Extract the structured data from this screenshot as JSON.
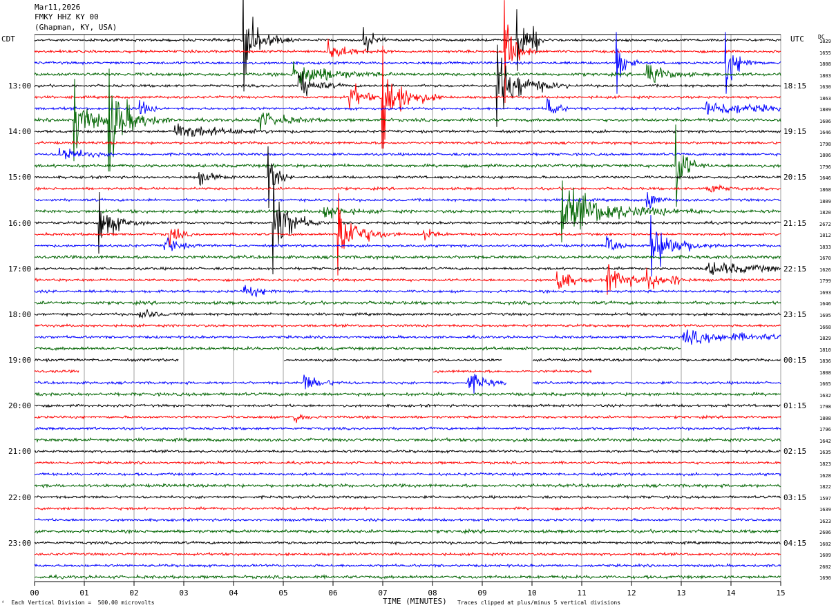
{
  "header": {
    "date": "Mar11,2026",
    "station": "FMKY HHZ KY 00",
    "location": "(Ghapman, KY, USA)"
  },
  "left_axis_label": "CDT",
  "right_axis_label": "UTC",
  "dc_label": "DC",
  "footer": {
    "scale_note": "Each Vertical Division =  500.00 microvolts",
    "xlabel": "TIME (MINUTES)",
    "clip_note": "Traces clipped at plus/minus 5 vertical divisions"
  },
  "colors": {
    "black": "#000000",
    "red": "#ff0000",
    "blue": "#0000ff",
    "green": "#006400",
    "grid": "#888888"
  },
  "chart_data": {
    "type": "helicorder",
    "title": "FMKY HHZ KY 00",
    "xlabel": "TIME (MINUTES)",
    "x_ticks": [
      "00",
      "01",
      "02",
      "03",
      "04",
      "05",
      "06",
      "07",
      "08",
      "09",
      "10",
      "11",
      "12",
      "13",
      "14",
      "15"
    ],
    "xlim": [
      0,
      15
    ],
    "trace_count": 48,
    "trace_minutes": 15,
    "color_cycle": [
      "black",
      "red",
      "blue",
      "green"
    ],
    "left_time_labels": [
      "13:00",
      "14:00",
      "15:00",
      "16:00",
      "17:00",
      "18:00",
      "19:00",
      "20:00",
      "21:00",
      "22:00",
      "23:00"
    ],
    "left_label_rows": [
      4,
      8,
      12,
      16,
      20,
      24,
      28,
      32,
      36,
      40,
      44
    ],
    "right_time_labels": [
      "18:15",
      "19:15",
      "20:15",
      "21:15",
      "22:15",
      "23:15",
      "00:15",
      "01:15",
      "02:15",
      "03:15",
      "04:15"
    ],
    "dc_offsets": [
      "1829",
      "1655",
      "1808",
      "1803",
      "1630",
      "1863",
      "1809",
      "1606",
      "1646",
      "1798",
      "1806",
      "1796",
      "1646",
      "1868",
      "1809",
      "1820",
      "2672",
      "1812",
      "1833",
      "1670",
      "1626",
      "1799",
      "1693",
      "1646",
      "1695",
      "1668",
      "1829",
      "1810",
      "1836",
      "1808",
      "1665",
      "1632",
      "1798",
      "1808",
      "1796",
      "1642",
      "1635",
      "1823",
      "1628",
      "1822",
      "1597",
      "1639",
      "1623",
      "2606",
      "1602",
      "1609",
      "2602",
      "1690"
    ],
    "events": [
      {
        "row": 0,
        "t": 4.2,
        "amp": 5,
        "dur": 0.4
      },
      {
        "row": 0,
        "t": 6.6,
        "amp": 2.5,
        "dur": 0.2
      },
      {
        "row": 0,
        "t": 9.7,
        "amp": 3,
        "dur": 0.2
      },
      {
        "row": 0,
        "t": 10.0,
        "amp": 2.5,
        "dur": 0.15
      },
      {
        "row": 1,
        "t": 9.45,
        "amp": 5,
        "dur": 0.25
      },
      {
        "row": 1,
        "t": 5.9,
        "amp": 1.2,
        "dur": 0.5
      },
      {
        "row": 2,
        "t": 11.7,
        "amp": 3,
        "dur": 0.2
      },
      {
        "row": 2,
        "t": 13.9,
        "amp": 3,
        "dur": 0.3
      },
      {
        "row": 3,
        "t": 5.2,
        "amp": 2,
        "dur": 0.8
      },
      {
        "row": 3,
        "t": 12.3,
        "amp": 2,
        "dur": 0.4
      },
      {
        "row": 4,
        "t": 5.3,
        "amp": 2,
        "dur": 0.4
      },
      {
        "row": 4,
        "t": 9.3,
        "amp": 4,
        "dur": 0.6
      },
      {
        "row": 5,
        "t": 7.0,
        "amp": 5,
        "dur": 0.5
      },
      {
        "row": 5,
        "t": 6.3,
        "amp": 2.5,
        "dur": 0.3
      },
      {
        "row": 6,
        "t": 2.1,
        "amp": 1.5,
        "dur": 0.2
      },
      {
        "row": 6,
        "t": 10.3,
        "amp": 2,
        "dur": 0.2
      },
      {
        "row": 6,
        "t": 13.5,
        "amp": 1,
        "dur": 1.3
      },
      {
        "row": 7,
        "t": 0.8,
        "amp": 4,
        "dur": 0.4
      },
      {
        "row": 7,
        "t": 1.5,
        "amp": 5,
        "dur": 0.5
      },
      {
        "row": 7,
        "t": 4.5,
        "amp": 1.2,
        "dur": 0.6
      },
      {
        "row": 8,
        "t": 2.8,
        "amp": 1.2,
        "dur": 1.0
      },
      {
        "row": 10,
        "t": 0.5,
        "amp": 1.2,
        "dur": 0.5
      },
      {
        "row": 11,
        "t": 12.9,
        "amp": 4,
        "dur": 0.25
      },
      {
        "row": 12,
        "t": 3.3,
        "amp": 1,
        "dur": 0.3
      },
      {
        "row": 12,
        "t": 4.7,
        "amp": 3,
        "dur": 0.2
      },
      {
        "row": 13,
        "t": 13.5,
        "amp": 1,
        "dur": 0.3
      },
      {
        "row": 14,
        "t": 12.3,
        "amp": 2,
        "dur": 0.2
      },
      {
        "row": 15,
        "t": 5.8,
        "amp": 1,
        "dur": 0.5
      },
      {
        "row": 15,
        "t": 10.6,
        "amp": 3,
        "dur": 1.2
      },
      {
        "row": 16,
        "t": 1.3,
        "amp": 3,
        "dur": 0.4
      },
      {
        "row": 16,
        "t": 4.8,
        "amp": 5,
        "dur": 0.4
      },
      {
        "row": 17,
        "t": 2.7,
        "amp": 2,
        "dur": 0.2
      },
      {
        "row": 17,
        "t": 6.1,
        "amp": 4,
        "dur": 0.5
      },
      {
        "row": 17,
        "t": 7.8,
        "amp": 1.5,
        "dur": 0.2
      },
      {
        "row": 18,
        "t": 2.6,
        "amp": 1.5,
        "dur": 0.3
      },
      {
        "row": 18,
        "t": 12.4,
        "amp": 3,
        "dur": 0.6
      },
      {
        "row": 18,
        "t": 11.5,
        "amp": 1.5,
        "dur": 0.2
      },
      {
        "row": 20,
        "t": 13.5,
        "amp": 0.8,
        "dur": 1.5
      },
      {
        "row": 21,
        "t": 10.5,
        "amp": 2,
        "dur": 0.3
      },
      {
        "row": 21,
        "t": 11.5,
        "amp": 2,
        "dur": 0.5
      },
      {
        "row": 21,
        "t": 12.3,
        "amp": 1.5,
        "dur": 0.3
      },
      {
        "row": 21,
        "t": 12.8,
        "amp": 1.2,
        "dur": 0.2
      },
      {
        "row": 22,
        "t": 4.2,
        "amp": 1,
        "dur": 0.4
      },
      {
        "row": 24,
        "t": 2.1,
        "amp": 1,
        "dur": 0.3
      },
      {
        "row": 26,
        "t": 13.0,
        "amp": 0.8,
        "dur": 2.0
      },
      {
        "row": 29,
        "t": 0.9,
        "amp": 1,
        "dur": 0.3
      },
      {
        "row": 30,
        "t": 5.4,
        "amp": 1.2,
        "dur": 0.4
      },
      {
        "row": 30,
        "t": 8.7,
        "amp": 1.5,
        "dur": 0.4
      },
      {
        "row": 33,
        "t": 5.2,
        "amp": 1,
        "dur": 0.2
      }
    ],
    "gaps": [
      {
        "row": 28,
        "t0": 2.9,
        "t1": 5.0
      },
      {
        "row": 28,
        "t0": 9.4,
        "t1": 10.0
      },
      {
        "row": 29,
        "t0": 0.9,
        "t1": 1.6
      },
      {
        "row": 29,
        "t0": 1.6,
        "t1": 8.0
      },
      {
        "row": 29,
        "t0": 11.2,
        "t1": 15.0
      },
      {
        "row": 30,
        "t0": 9.5,
        "t1": 10.0
      },
      {
        "row": 27,
        "t0": 13.0,
        "t1": 15.0
      }
    ]
  }
}
